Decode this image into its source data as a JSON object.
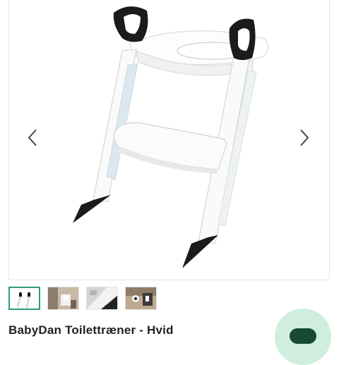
{
  "product": {
    "title": "BabyDan Toilettræner - Hvid",
    "image_subject": "white toilet trainer ladder with black handles"
  },
  "gallery": {
    "prev_icon": "chevron-left-icon",
    "next_icon": "chevron-right-icon",
    "thumbnails": [
      {
        "icon": "product-thumbnail",
        "selected": true
      },
      {
        "icon": "bathroom-thumbnail",
        "selected": false
      },
      {
        "icon": "closeup-thumbnail",
        "selected": false
      },
      {
        "icon": "toilet-thumbnail",
        "selected": false
      }
    ]
  },
  "colors": {
    "accent": "#2e9c6f",
    "fab_bg": "#cfeedd",
    "fab_icon": "#164a35"
  }
}
